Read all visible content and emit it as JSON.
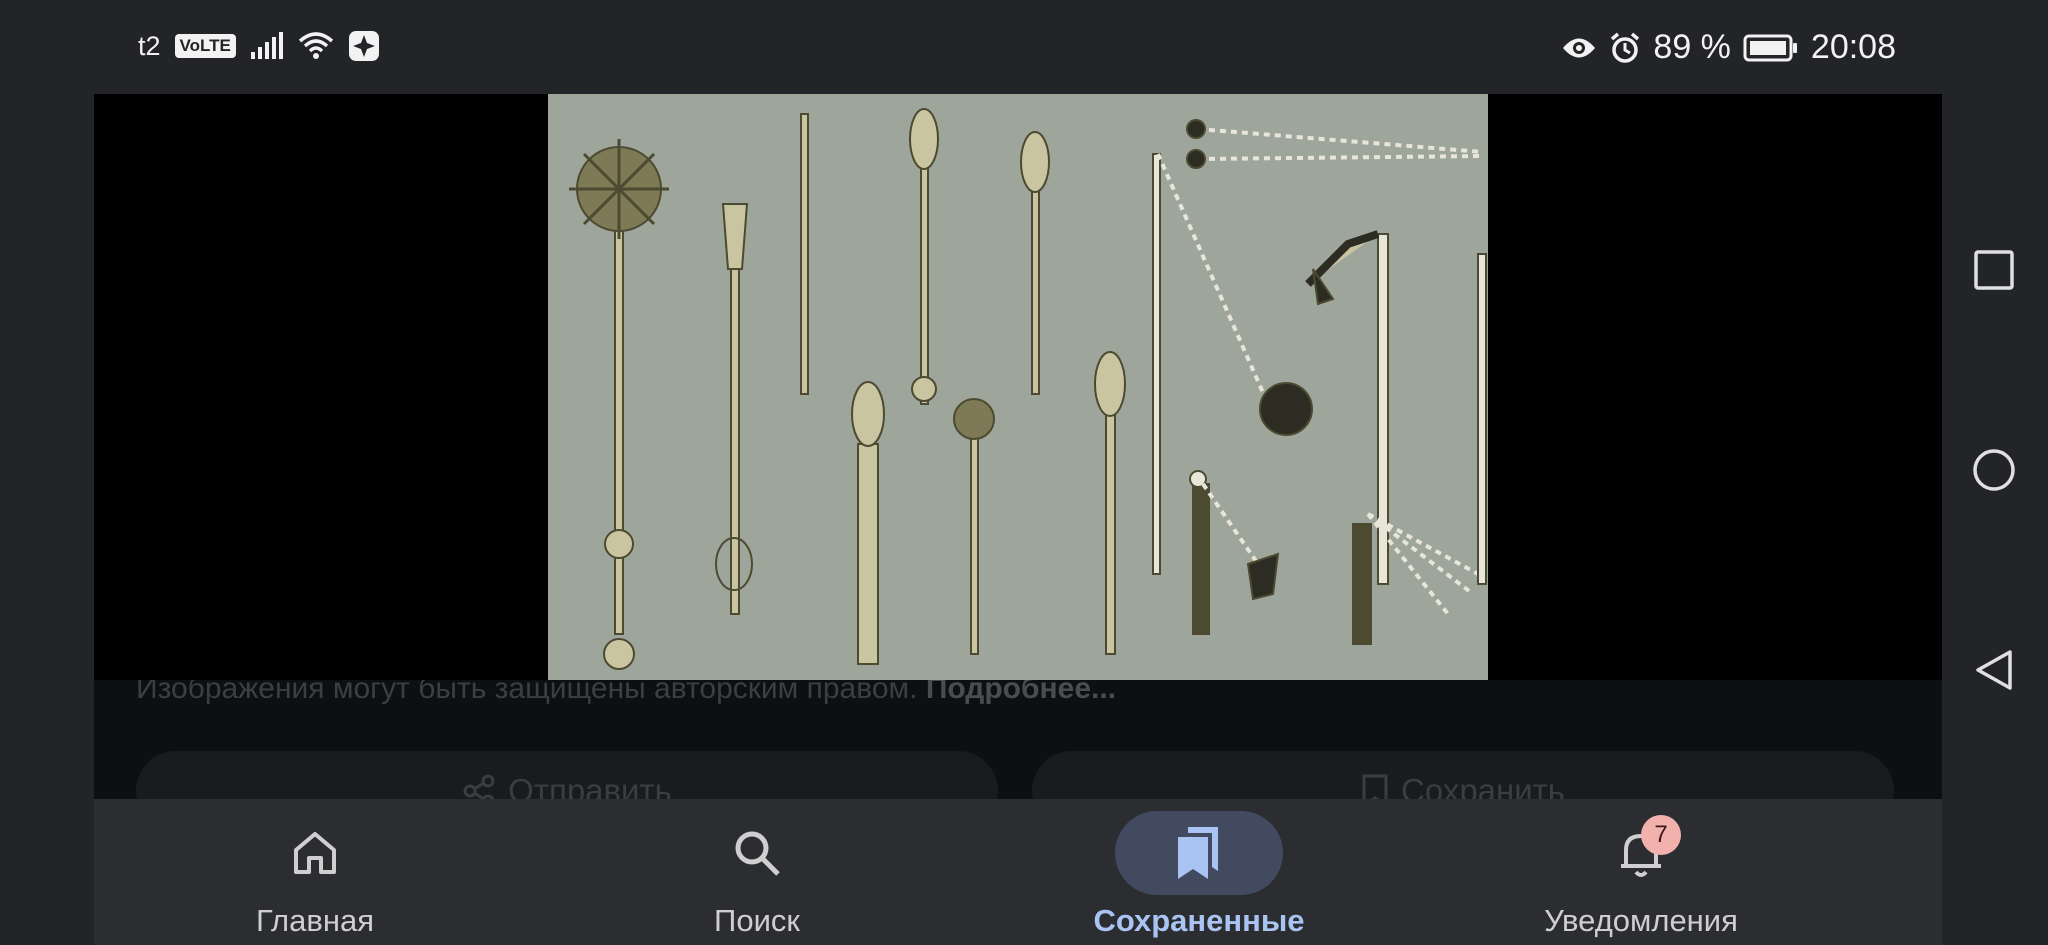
{
  "status_bar": {
    "carrier": "t2",
    "volte": "VoLTE",
    "battery_percent": "89 %",
    "time": "20:08",
    "icons": [
      "signal-icon",
      "wifi-icon",
      "app-icon",
      "eye-icon",
      "alarm-icon",
      "battery-icon"
    ]
  },
  "content": {
    "copyright_text": "Изображения могут быть защищены авторским правом.",
    "copyright_link": "Подробнее...",
    "share_label": "Отправить",
    "save_label": "Сохранить"
  },
  "bottom_nav": {
    "items": [
      {
        "label": "Главная",
        "icon": "home-icon",
        "active": false
      },
      {
        "label": "Поиск",
        "icon": "search-icon",
        "active": false
      },
      {
        "label": "Сохраненные",
        "icon": "bookmarks-icon",
        "active": true
      },
      {
        "label": "Уведомления",
        "icon": "bell-icon",
        "active": false,
        "badge": "7"
      }
    ]
  },
  "system_nav": [
    "recents-square-icon",
    "home-circle-icon",
    "back-triangle-icon"
  ],
  "colors": {
    "background": "#232427",
    "nav_active": "#a9c3f2",
    "nav_active_pill": "#414a5f",
    "badge": "#f3b1ad",
    "photo_bg": "#9ea69c"
  }
}
